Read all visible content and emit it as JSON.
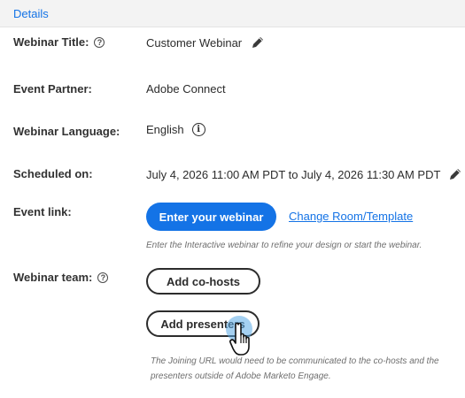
{
  "header": {
    "title": "Details"
  },
  "fields": {
    "title": {
      "label": "Webinar Title:",
      "value": "Customer Webinar"
    },
    "partner": {
      "label": "Event Partner:",
      "value": "Adobe Connect"
    },
    "language": {
      "label": "Webinar Language:",
      "value": "English"
    },
    "schedule": {
      "label": "Scheduled on:",
      "value": "July 4, 2026 11:00 AM PDT to July 4, 2026 11:30 AM PDT"
    },
    "event_link": {
      "label": "Event link:",
      "button": "Enter your webinar",
      "link": "Change Room/Template",
      "hint": "Enter the Interactive webinar to refine your design or start the webinar."
    },
    "team": {
      "label": "Webinar team:",
      "cohosts_button": "Add co-hosts",
      "presenters_button": "Add presenters",
      "note_line1": "The Joining URL would need to be communicated to the co-hosts and the",
      "note_line2": "presenters outside of Adobe Marketo Engage."
    }
  },
  "colors": {
    "accent": "#1473e6",
    "header_bg": "#f3f3f3",
    "hint_text": "#6e6e6e"
  },
  "icons": [
    "help-icon",
    "info-icon",
    "pencil-icon",
    "hand-cursor-icon"
  ]
}
